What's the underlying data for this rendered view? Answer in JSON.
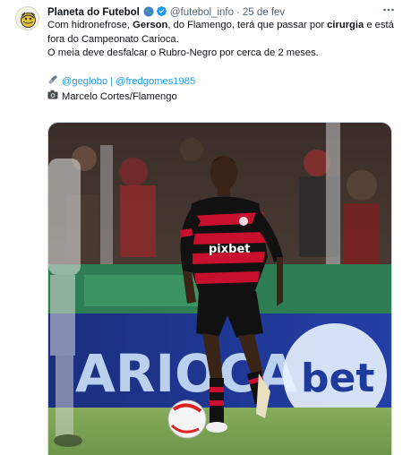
{
  "author": {
    "display_name": "Planeta do Futebol",
    "handle": "@futebol_info",
    "separator": "·",
    "timestamp": "25 de fev",
    "globe_icon": "globe-icon",
    "verified_icon": "verified-badge-icon",
    "more_icon": "more-options-icon"
  },
  "tweet": {
    "line1_pre": "Com hidronefrose, ",
    "line1_bold1": "Gerson",
    "line1_mid": ", do Flamengo, terá que passar por ",
    "line1_bold2": "cirurgia",
    "line1_post": " e está fora do Campeonato Carioca.",
    "line2": "O meia deve desfalcar o Rubro-Negro por cerca de 2 meses.",
    "link1": "@geglobo",
    "link_separator": "|",
    "link2": "@fredgomes1985",
    "credit": "Marcelo Cortes/Flamengo"
  },
  "media": {
    "banner_text": "ARIOCA",
    "banner_brand": "bet",
    "jersey_sponsor": "pixbet",
    "description_colors": {
      "red": "#c8102e",
      "black": "#111111",
      "pitch": "#7fa85a",
      "banner": "#1e3a9b"
    }
  }
}
